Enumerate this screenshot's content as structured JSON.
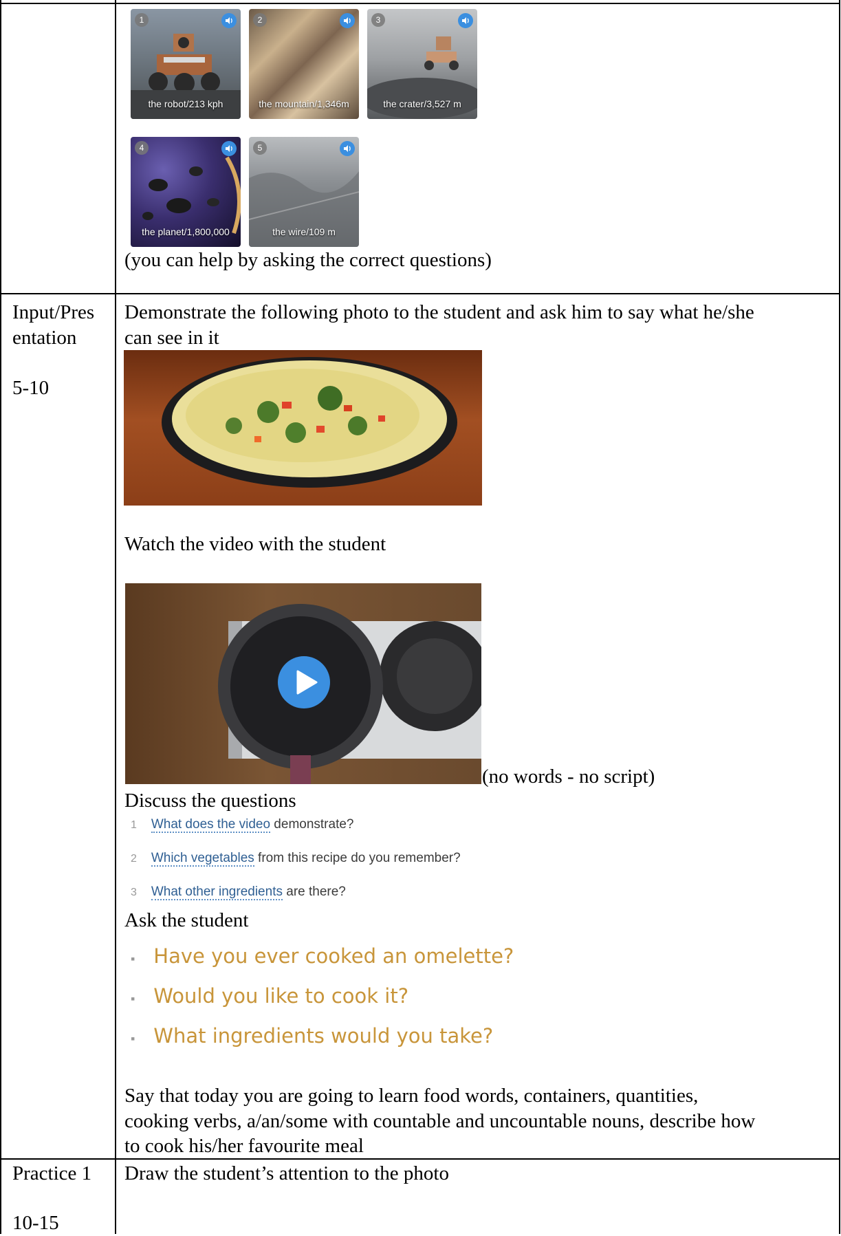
{
  "tiles": [
    {
      "number": "1",
      "caption": "the robot/213 kph",
      "audio_icon": "speaker-icon"
    },
    {
      "number": "2",
      "caption": "the mountain/1,346m",
      "audio_icon": "speaker-icon"
    },
    {
      "number": "3",
      "caption": "the crater/3,527 m",
      "audio_icon": "speaker-icon"
    },
    {
      "number": "4",
      "caption": "the planet/1,800,000",
      "audio_icon": "speaker-icon"
    },
    {
      "number": "5",
      "caption": "the wire/109 m",
      "audio_icon": "speaker-icon"
    }
  ],
  "row0": {
    "note": "(you can help by asking the correct questions)"
  },
  "row1": {
    "stage_line1": "Input/Pres",
    "stage_line2": "entation",
    "time": "5-10",
    "instruction_line1": "Demonstrate the following photo to the student and ask him to say what he/she",
    "instruction_line2": "can see in it",
    "watch": "Watch the video with the student",
    "video_note": "(no words - no script)",
    "discuss": "Discuss the questions",
    "questions": [
      {
        "num": "1",
        "link": "What does the video",
        "rest": " demonstrate?"
      },
      {
        "num": "2",
        "link": "Which vegetables",
        "rest": " from this recipe do you remember?"
      },
      {
        "num": "3",
        "link": "What other ingredients",
        "rest": " are there?"
      }
    ],
    "ask": "Ask the student",
    "ask_items": [
      "Have you ever cooked an omelette?",
      "Would you like to cook it?",
      "What ingredients would you take?"
    ],
    "say_line1": "Say that today you are going to learn food words, containers, quantities,",
    "say_line2": "cooking verbs, a/an/some with countable and uncountable nouns, describe how",
    "say_line3": "to cook his/her favourite meal"
  },
  "row2": {
    "stage": "Practice 1",
    "time": "10-15",
    "instruction": "Draw the student’s attention to the photo"
  },
  "colors": {
    "audio_badge": "#3b8fe0",
    "question_link": "#2f5f93",
    "ask_text": "#c8953a",
    "play_button": "#3b8fe0"
  }
}
